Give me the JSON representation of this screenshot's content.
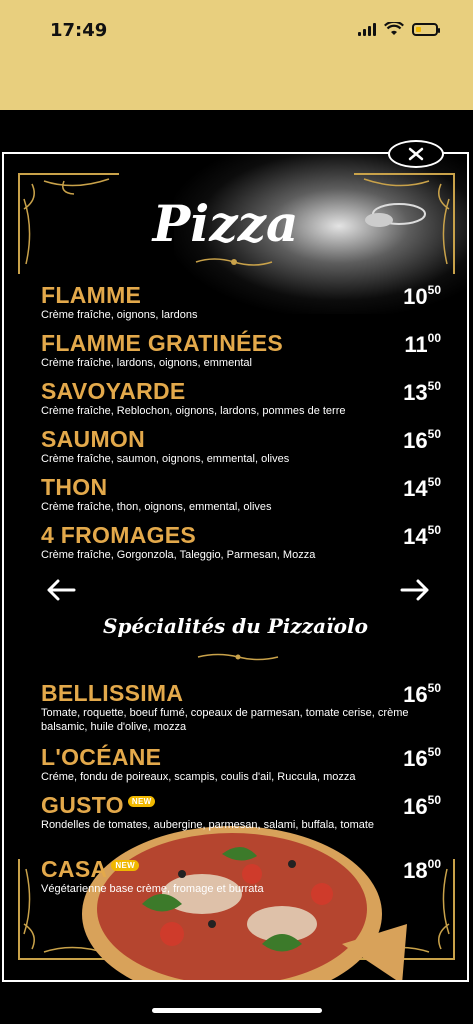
{
  "status": {
    "time": "17:49",
    "battery_level": 0.3,
    "accent_color": "#e8cf7e"
  },
  "menu": {
    "title": "Pizza",
    "close_icon": "close-icon",
    "colors": {
      "name": "#e3a94b",
      "price": "#ffffff",
      "badge": "#f0b800"
    },
    "pizzas": [
      {
        "name": "FLAMME",
        "price_int": "10",
        "price_dec": "50",
        "desc": "Crème fraîche, oignons, lardons"
      },
      {
        "name": "FLAMME GRATINÉES",
        "price_int": "11",
        "price_dec": "00",
        "desc": "Crème fraîche, lardons, oignons, emmental"
      },
      {
        "name": "SAVOYARDE",
        "price_int": "13",
        "price_dec": "50",
        "desc": "Crème fraîche, Reblochon, oignons, lardons, pommes de terre"
      },
      {
        "name": "SAUMON",
        "price_int": "16",
        "price_dec": "50",
        "desc": "Crème fraîche, saumon, oignons, emmental, olives"
      },
      {
        "name": "THON",
        "price_int": "14",
        "price_dec": "50",
        "desc": "Crème fraîche, thon, oignons, emmental, olives"
      },
      {
        "name": "4 FROMAGES",
        "price_int": "14",
        "price_dec": "50",
        "desc": "Crème fraîche, Gorgonzola, Taleggio, Parmesan, Mozza"
      }
    ],
    "nav": {
      "prev_icon": "arrow-left-icon",
      "next_icon": "arrow-right-icon"
    },
    "specials_title": "Spécialités du Pizzaïolo",
    "specials": [
      {
        "name": "BELLISSIMA",
        "badge": "",
        "price_int": "16",
        "price_dec": "50",
        "desc": "Tomate, roquette, boeuf fumé, copeaux de parmesan, tomate cerise, crème balsamic, huile d'olive, mozza"
      },
      {
        "name": "L'OCÉANE",
        "badge": "",
        "price_int": "16",
        "price_dec": "50",
        "desc": "Créme, fondu de poireaux, scampis, coulis d'ail, Ruccula, mozza"
      },
      {
        "name": "GUSTO",
        "badge": "NEW",
        "price_int": "16",
        "price_dec": "50",
        "desc": "Rondelles de tomates, aubergine, parmesan, salami, buffala, tomate"
      },
      {
        "name": "CASA",
        "badge": "NEW",
        "price_int": "18",
        "price_dec": "00",
        "desc": "Végétarienne base crème, fromage et burrata"
      }
    ]
  }
}
